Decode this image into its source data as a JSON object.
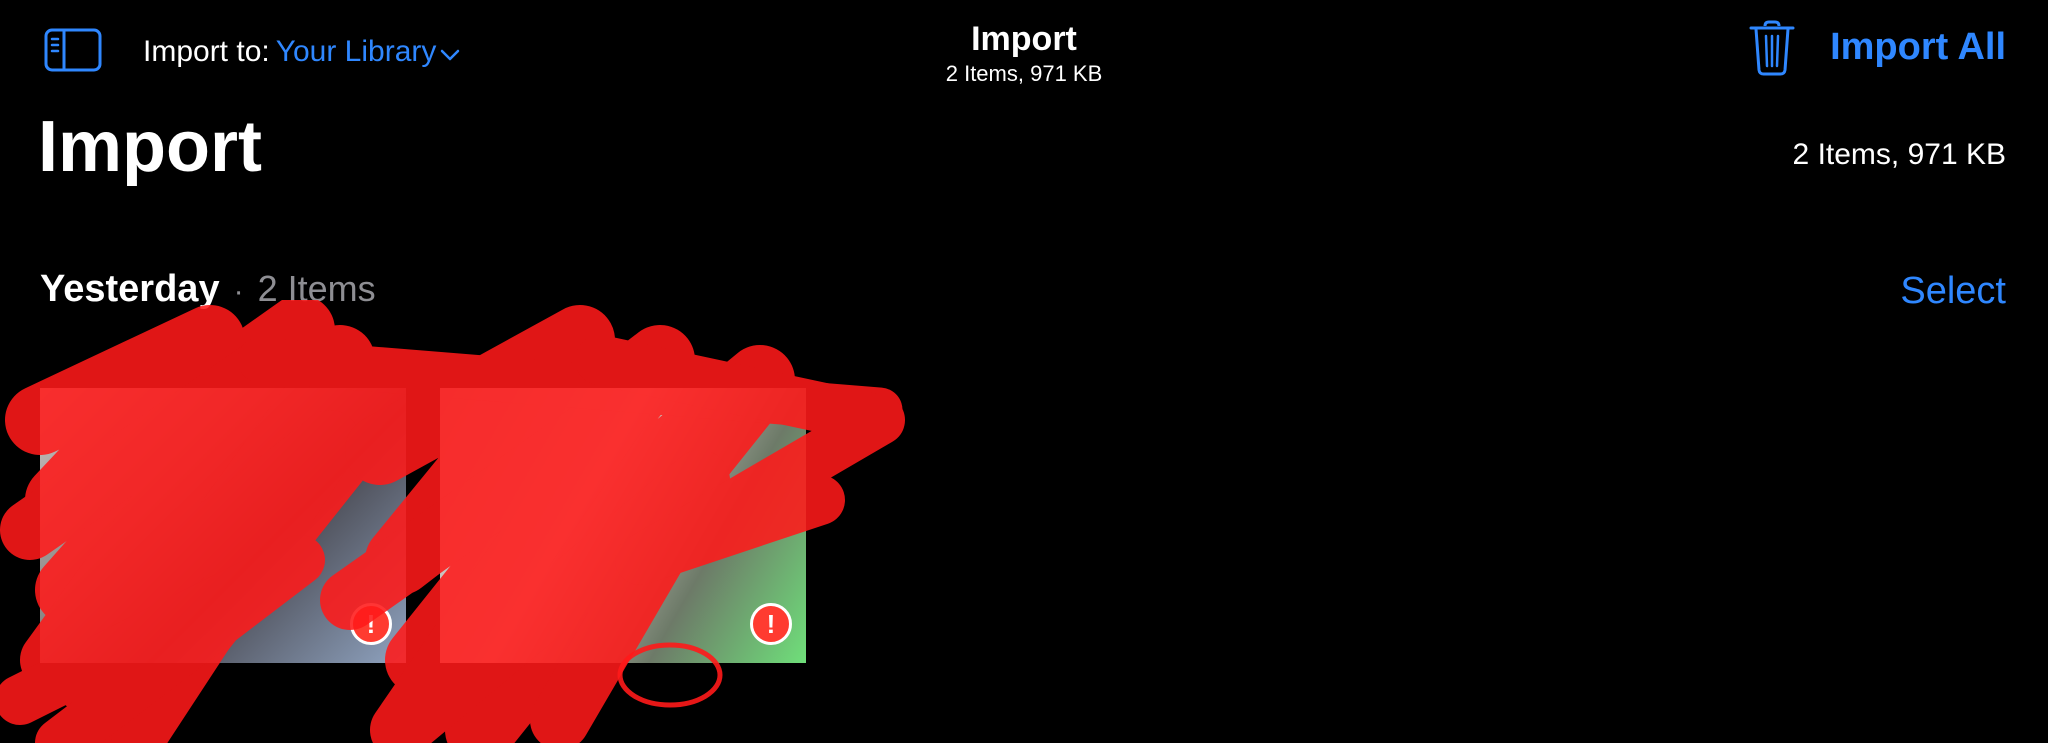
{
  "nav": {
    "import_to_label": "Import to:",
    "library_label": "Your Library",
    "title": "Import",
    "subtitle": "2 Items, 971 KB",
    "import_all_label": "Import All",
    "icons": {
      "sidebar": "sidebar-icon",
      "chevron": "chevron-down-icon",
      "trash": "trash-icon"
    }
  },
  "header": {
    "title": "Import",
    "summary": "2 Items, 971 KB"
  },
  "section": {
    "day": "Yesterday",
    "separator": "·",
    "count": "2 Items",
    "select_label": "Select"
  },
  "items": [
    {
      "warning_glyph": "!",
      "warning_icon": "exclamation-circle-icon"
    },
    {
      "warning_glyph": "!",
      "warning_icon": "exclamation-circle-icon"
    }
  ],
  "colors": {
    "accent": "#2f87ff",
    "background": "#000000",
    "secondary_text": "#8e8e93",
    "warning": "#ff3b30",
    "redaction": "#ff1a1a"
  }
}
